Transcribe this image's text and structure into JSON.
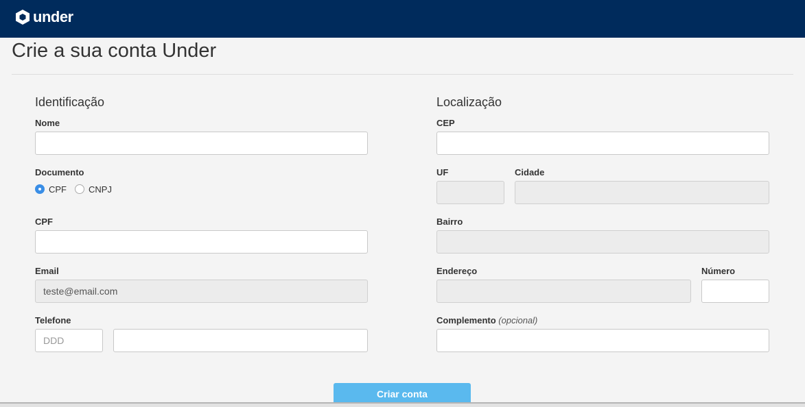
{
  "header": {
    "logo_text": "under",
    "logo_icon": "hexagon-logo-icon",
    "background": "#002b5c"
  },
  "page": {
    "title": "Crie a sua conta Under"
  },
  "identificacao": {
    "title": "Identificação",
    "nome": {
      "label": "Nome",
      "value": ""
    },
    "documento": {
      "label": "Documento",
      "options": [
        {
          "label": "CPF",
          "selected": true
        },
        {
          "label": "CNPJ",
          "selected": false
        }
      ]
    },
    "cpf": {
      "label": "CPF",
      "value": ""
    },
    "email": {
      "label": "Email",
      "value": "teste@email.com",
      "disabled": true
    },
    "telefone": {
      "label": "Telefone",
      "ddd_placeholder": "DDD",
      "number_value": ""
    }
  },
  "localizacao": {
    "title": "Localização",
    "cep": {
      "label": "CEP",
      "value": ""
    },
    "uf": {
      "label": "UF",
      "value": "",
      "disabled": true
    },
    "cidade": {
      "label": "Cidade",
      "value": "",
      "disabled": true
    },
    "bairro": {
      "label": "Bairro",
      "value": "",
      "disabled": true
    },
    "endereco": {
      "label": "Endereço",
      "value": "",
      "disabled": true
    },
    "numero": {
      "label": "Número",
      "value": ""
    },
    "complemento": {
      "label": "Complemento",
      "optional_note": "(opcional)",
      "value": ""
    }
  },
  "submit": {
    "label": "Criar conta",
    "color": "#5ab9ee"
  }
}
